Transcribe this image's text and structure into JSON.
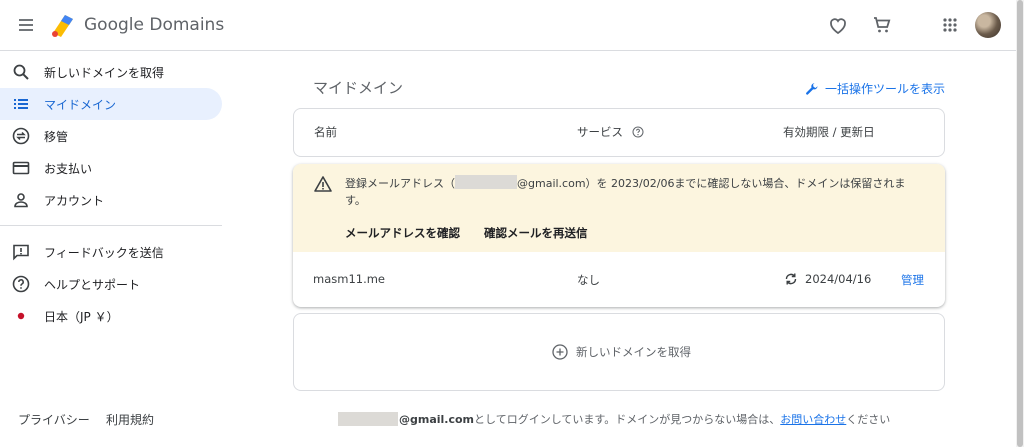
{
  "header": {
    "brand": "Google Domains",
    "icons": [
      "menu-icon",
      "favorite-heart-icon",
      "cart-icon",
      "apps-grid-icon",
      "avatar"
    ]
  },
  "sidebar": {
    "items": [
      {
        "label": "新しいドメインを取得",
        "icon": "search-icon"
      },
      {
        "label": "マイドメイン",
        "icon": "list-icon",
        "active": true
      },
      {
        "label": "移管",
        "icon": "transfer-icon"
      },
      {
        "label": "お支払い",
        "icon": "credit-card-icon"
      },
      {
        "label": "アカウント",
        "icon": "person-icon"
      },
      {
        "label": "フィードバックを送信",
        "icon": "feedback-icon"
      },
      {
        "label": "ヘルプとサポート",
        "icon": "help-icon"
      },
      {
        "label": "日本（JP ￥）",
        "icon": "japan-flag-dot"
      }
    ],
    "footer": {
      "privacy": "プライバシー",
      "terms": "利用規約"
    }
  },
  "main": {
    "title": "マイドメイン",
    "bulk_tool": "一括操作ツールを表示",
    "columns": {
      "name": "名前",
      "services": "サービス",
      "expiry": "有効期限 / 更新日"
    },
    "warning": {
      "text_before": "登録メールアドレス（",
      "text_after": "@gmail.com）を 2023/02/06までに確認しない場合、ドメインは保留されます。",
      "action_verify": "メールアドレスを確認",
      "action_resend": "確認メールを再送信"
    },
    "domain_row": {
      "name": "masm11.me",
      "services": "なし",
      "expiry": "2024/04/16",
      "manage": "管理"
    },
    "add_domain": "新しいドメインを取得",
    "bottom_note": {
      "email_suffix": "@gmail.com",
      "text": " としてログインしています。ドメインが見つからない場合は、",
      "contact": "お問い合わせ",
      "tail": "ください"
    }
  },
  "colors": {
    "accent": "#1a73e8",
    "active_bg": "#e8f0fe",
    "warning_bg": "#fcf5df"
  }
}
